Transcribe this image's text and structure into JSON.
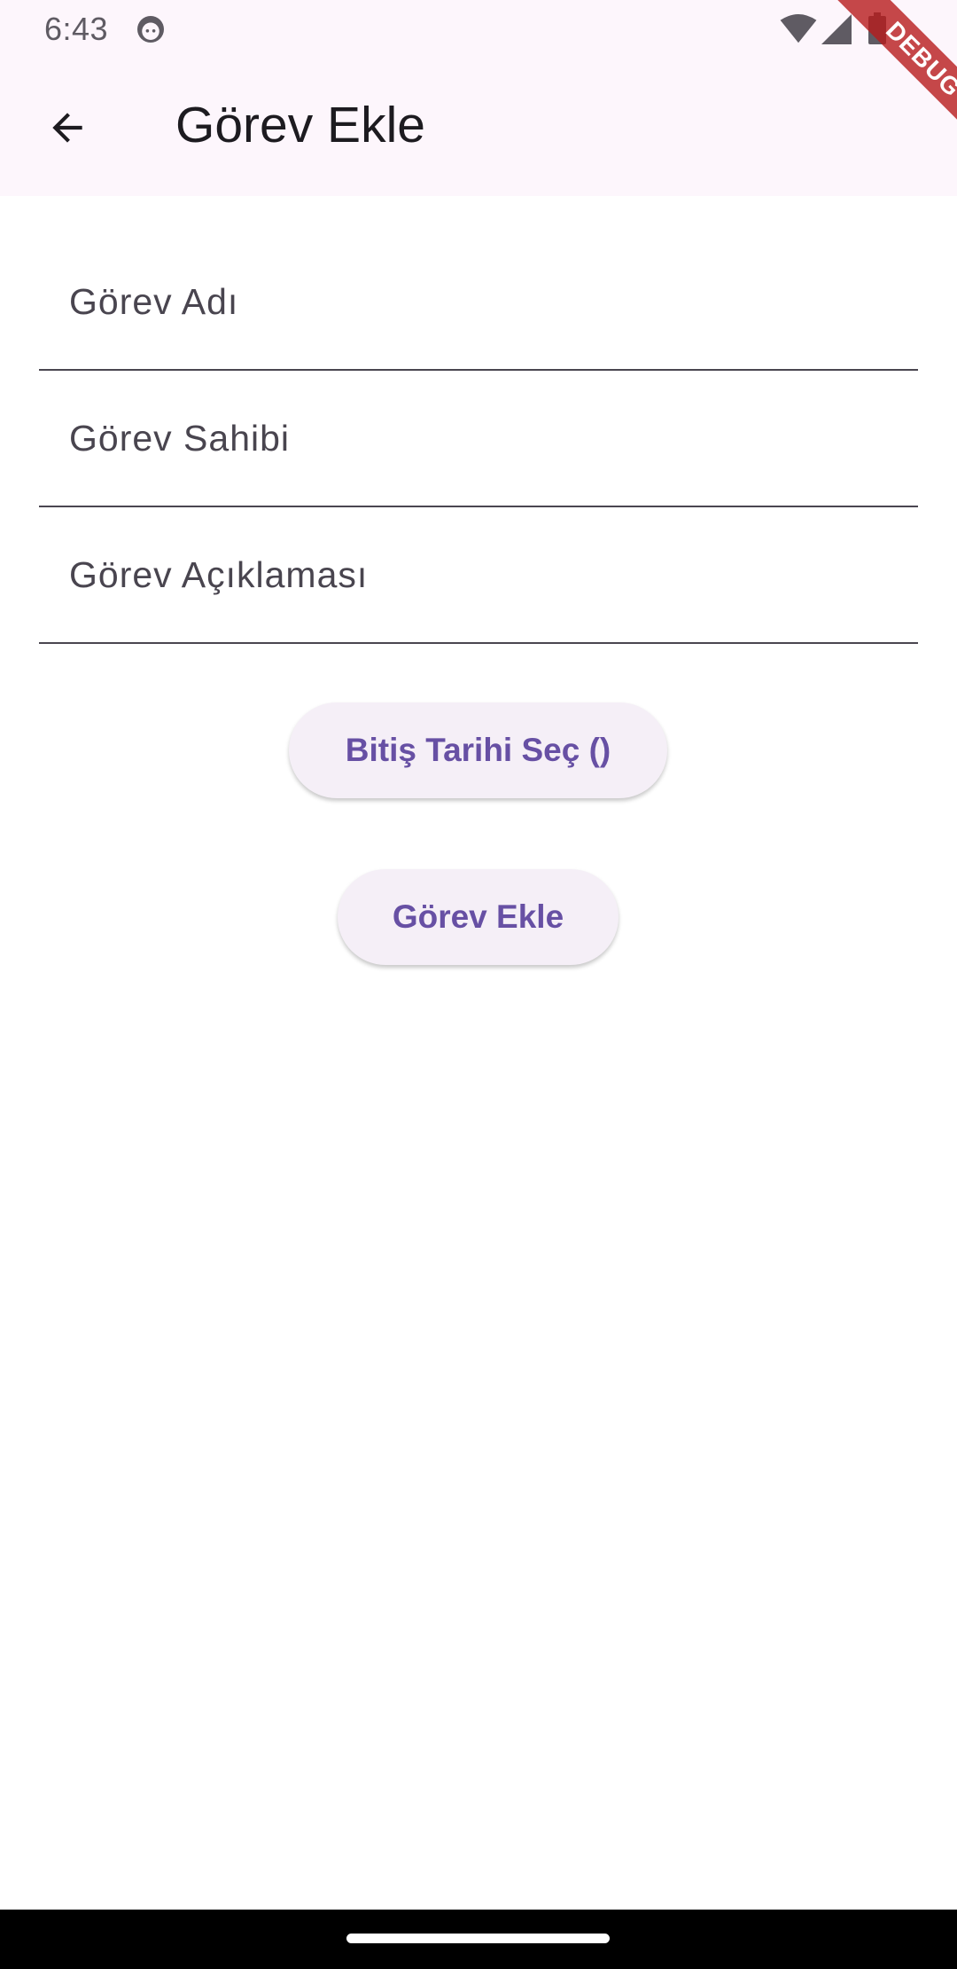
{
  "status_bar": {
    "time": "6:43",
    "icons": [
      "android-head-icon",
      "wifi-icon",
      "signal-icon",
      "battery-icon"
    ]
  },
  "app_bar": {
    "title": "Görev Ekle",
    "back_icon": "arrow-back-icon"
  },
  "debug_banner": {
    "label": "DEBUG",
    "color": "#b71c1c"
  },
  "form": {
    "task_name": {
      "placeholder": "Görev Adı",
      "value": ""
    },
    "task_owner": {
      "placeholder": "Görev Sahibi",
      "value": ""
    },
    "task_description": {
      "placeholder": "Görev Açıklaması",
      "value": ""
    }
  },
  "buttons": {
    "pick_due_date": "Bitiş Tarihi Seç ()",
    "add_task": "Görev Ekle"
  },
  "colors": {
    "app_bar_background": "#fdf6fc",
    "button_background": "#f5eff7",
    "button_text": "#6750a4",
    "field_underline": "#4a4650"
  }
}
